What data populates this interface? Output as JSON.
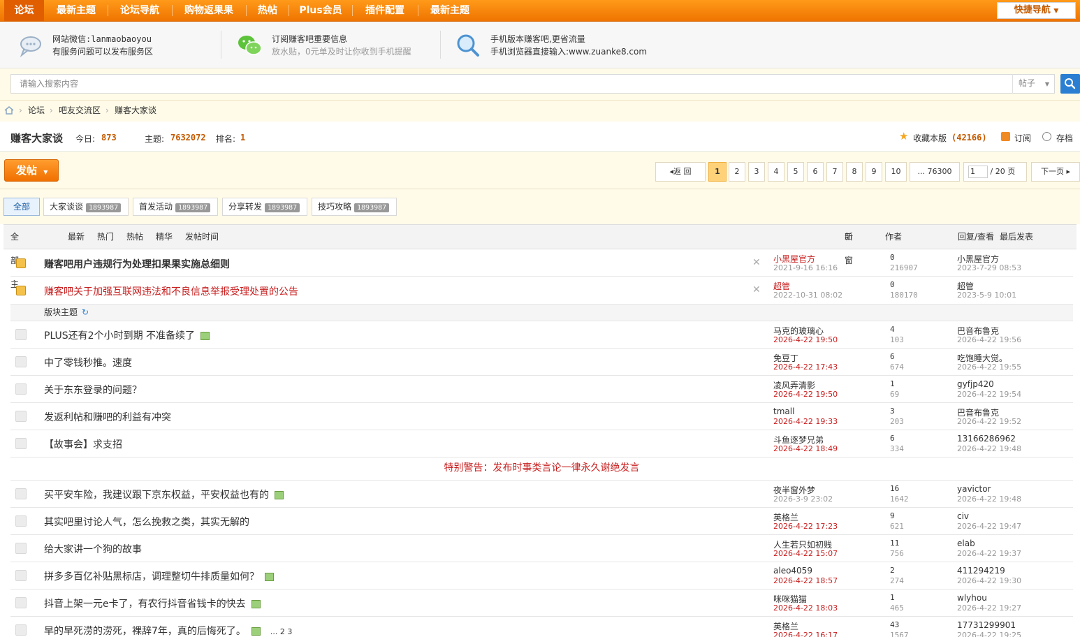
{
  "topnav": {
    "items": [
      "论坛",
      "最新主题",
      "论坛导航",
      "购物返果果",
      "热帖",
      "Plus会员",
      "插件配置",
      "最新主题"
    ],
    "quick_nav": "快捷导航"
  },
  "info": [
    {
      "line1": "网站微信:lanmaobaoyou",
      "line2": "有服务问题可以发布服务区",
      "icon": "chat-bubble-icon"
    },
    {
      "line1": "订阅赚客吧重要信息",
      "line2": "放水贴，0元单及时让你收到手机提醒",
      "icon": "wechat-icon"
    },
    {
      "line1": "手机版本赚客吧,更省流量",
      "line2": "手机浏览器直接输入:www.zuanke8.com",
      "icon": "magnifier-icon"
    }
  ],
  "search": {
    "placeholder": "请输入搜索内容",
    "type": "帖子"
  },
  "breadcrumb": [
    "论坛",
    "吧友交流区",
    "赚客大家谈"
  ],
  "forum": {
    "name": "赚客大家谈",
    "today_label": "今日:",
    "today": "873",
    "topics_label": "主题:",
    "topics": "7632072",
    "rank_label": "排名:",
    "rank": "1",
    "fav_label": "收藏本版",
    "fav_count": "(42166)",
    "subscribe": "订阅",
    "archive": "存档"
  },
  "post_button": "发帖",
  "pager": {
    "back": "返 回",
    "pages": [
      "1",
      "2",
      "3",
      "4",
      "5",
      "6",
      "7",
      "8",
      "9",
      "10"
    ],
    "last": "... 76300",
    "input": "1",
    "total": "/ 20 页",
    "next": "下一页"
  },
  "tabs": [
    {
      "label": "全部",
      "count": ""
    },
    {
      "label": "大家谈谈",
      "count": "1893987"
    },
    {
      "label": "首发活动",
      "count": "1893987"
    },
    {
      "label": "分享转发",
      "count": "1893987"
    },
    {
      "label": "技巧攻略",
      "count": "1893987"
    }
  ],
  "list_header": {
    "all": "全部主题",
    "newest": "最新",
    "hot": "热门",
    "hotpost": "热帖",
    "digest": "精华",
    "posttime": "发帖时间",
    "newwin": "新窗",
    "author": "作者",
    "reply_view": "回复/查看",
    "last_post": "最后发表"
  },
  "pinned": [
    {
      "title": "赚客吧用户违规行为处理扣果果实施总细则",
      "author": "小黑屋官方",
      "date": "2021-9-16 16:16",
      "replies": "0",
      "views": "216907",
      "last_user": "小黑屋官方",
      "last_date": "2023-7-29 08:53"
    },
    {
      "title": "赚客吧关于加强互联网违法和不良信息举报受理处置的公告",
      "author": "超管",
      "date": "2022-10-31 08:02",
      "replies": "0",
      "views": "180170",
      "last_user": "超管",
      "last_date": "2023-5-9 10:01"
    }
  ],
  "section_label": "版块主题",
  "threads": [
    {
      "title": "PLUS还有2个小时到期 不准备续了",
      "author": "马克的玻璃心",
      "date": "2026-4-22 19:50",
      "replies": "4",
      "views": "103",
      "last_user": "巴音布鲁克",
      "last_date": "2026-4-22 19:56"
    },
    {
      "title": "中了零钱秒推。速度",
      "author": "免豆丁",
      "date": "2026-4-22 17:43",
      "replies": "6",
      "views": "674",
      "last_user": "吃饱睡大觉。",
      "last_date": "2026-4-22 19:55"
    },
    {
      "title": "关于东东登录的问题？",
      "author": "凌风弄清影",
      "date": "2026-4-22 19:50",
      "replies": "1",
      "views": "69",
      "last_user": "gyfjp420",
      "last_date": "2026-4-22 19:54"
    },
    {
      "title": "发返利帖和赚吧的利益有冲突",
      "author": "tmall",
      "date": "2026-4-22 19:33",
      "replies": "3",
      "views": "203",
      "last_user": "巴音布鲁克",
      "last_date": "2026-4-22 19:52"
    },
    {
      "title": "【故事会】求支招",
      "author": "斗鱼逐梦兄弟",
      "date": "2026-4-22 18:49",
      "replies": "6",
      "views": "334",
      "last_user": "13166286962",
      "last_date": "2026-4-22 19:48"
    }
  ],
  "warning": "特别警告：发布时事类言论一律永久谢绝发言",
  "threads2": [
    {
      "title": "买平安车险，我建议跟下京东权益，平安权益也有的",
      "author": "夜半窗外梦",
      "date": "2026-3-9 23:02",
      "replies": "16",
      "views": "1642",
      "last_user": "yavictor",
      "last_date": "2026-4-22 19:48"
    },
    {
      "title": "其实吧里讨论人气，怎么挽救之类，其实无解的",
      "author": "英格兰",
      "date": "2026-4-22 17:23",
      "replies": "9",
      "views": "621",
      "last_user": "civ",
      "last_date": "2026-4-22 19:47"
    },
    {
      "title": "给大家讲一个狗的故事",
      "author": "人生若只如初贱",
      "date": "2026-4-22 15:07",
      "replies": "11",
      "views": "756",
      "last_user": "elab",
      "last_date": "2026-4-22 19:37"
    },
    {
      "title": "拼多多百亿补贴黑标店，调理整切牛排质量如何？",
      "author": "aleo4059",
      "date": "2026-4-22 18:57",
      "replies": "2",
      "views": "274",
      "last_user": "411294219",
      "last_date": "2026-4-22 19:30"
    },
    {
      "title": "抖音上架一元e卡了，有农行抖音省钱卡的快去",
      "author": "咪咪猫猫",
      "date": "2026-4-22 18:03",
      "replies": "1",
      "views": "465",
      "last_user": "wlyhou",
      "last_date": "2026-4-22 19:27"
    },
    {
      "title": "早的早死涝的涝死，裸辞7年，真的后悔死了。",
      "author": "英格兰",
      "date": "2026-4-22 16:17",
      "replies": "43",
      "views": "1567",
      "last_user": "17731299901",
      "last_date": "2026-4-22 19:25",
      "pages": "... 2 3"
    }
  ]
}
